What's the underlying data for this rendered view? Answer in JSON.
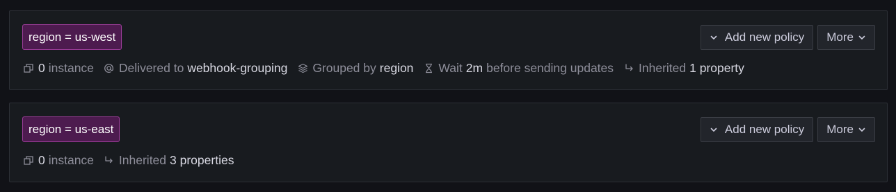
{
  "policies": [
    {
      "matcher": "region = us-west",
      "add_label": "Add new policy",
      "more_label": "More",
      "instances": {
        "count": "0",
        "label": "instance"
      },
      "delivered": {
        "label": "Delivered to",
        "value": "webhook-grouping"
      },
      "grouped": {
        "label": "Grouped by",
        "value": "region"
      },
      "wait": {
        "prefix": "Wait",
        "value": "2m",
        "suffix": "before sending updates"
      },
      "inherited": {
        "label": "Inherited",
        "value": "1 property"
      }
    },
    {
      "matcher": "region = us-east",
      "add_label": "Add new policy",
      "more_label": "More",
      "instances": {
        "count": "0",
        "label": "instance"
      },
      "inherited": {
        "label": "Inherited",
        "value": "3 properties"
      }
    }
  ],
  "icons": {
    "instances": "layers-alt-icon",
    "delivered": "at-icon",
    "grouped": "layer-group-icon",
    "wait": "hourglass-icon",
    "inherited": "corner-down-right-arrow-icon",
    "chevron": "chevron-down-icon"
  },
  "colors": {
    "background": "#111217",
    "card": "#181b1f",
    "matcher_bg": "#4d1b4f",
    "matcher_border": "#9c3d99",
    "button_bg": "#22252b"
  }
}
